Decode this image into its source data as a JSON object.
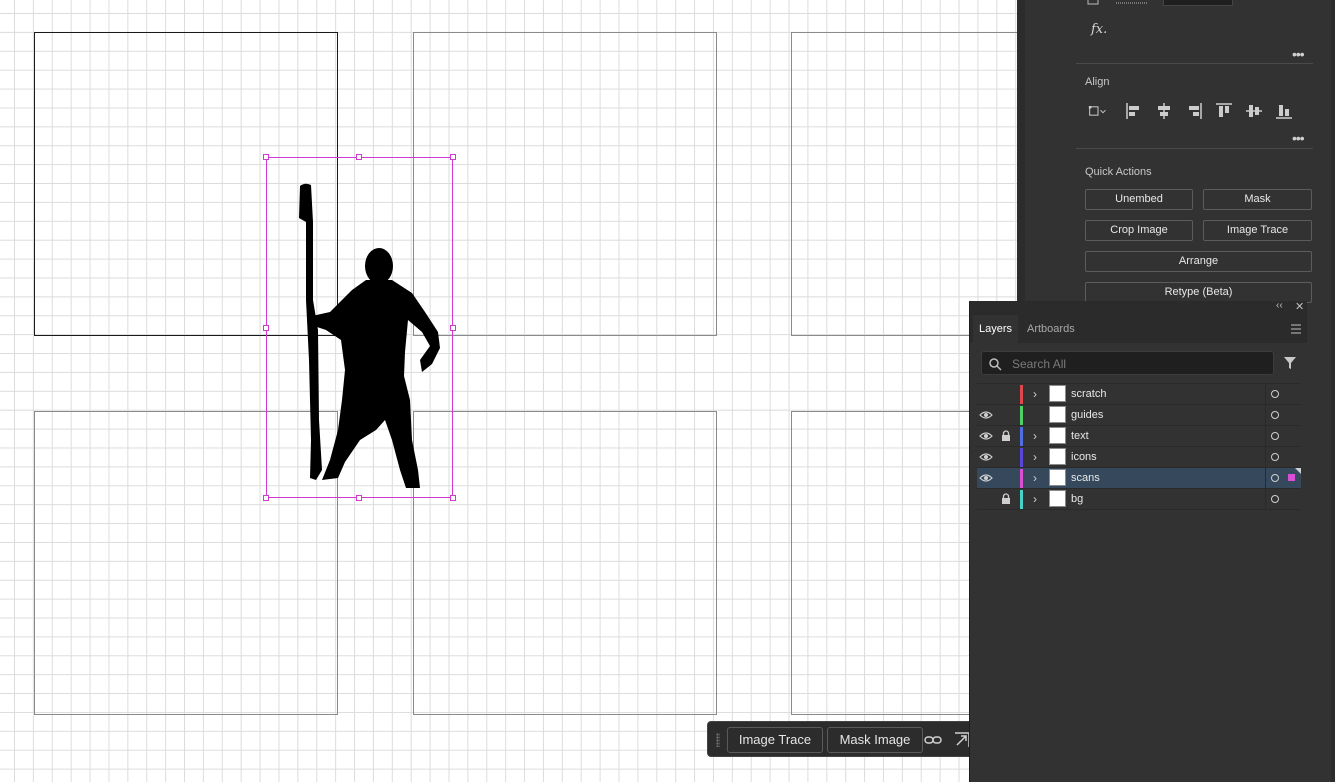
{
  "canvas": {
    "artboards": [
      "artboard-1",
      "artboard-2",
      "artboard-3",
      "artboard-4",
      "artboard-5",
      "artboard-6"
    ]
  },
  "taskbar": {
    "image_trace_label": "Image Trace",
    "mask_image_label": "Mask Image",
    "icons": [
      "link-icon",
      "expand-icon"
    ]
  },
  "properties": {
    "fx_label": "fx.",
    "align": {
      "title": "Align"
    },
    "quick_actions": {
      "title": "Quick Actions",
      "unembed": "Unembed",
      "mask": "Mask",
      "crop_image": "Crop Image",
      "image_trace": "Image Trace",
      "arrange": "Arrange",
      "retype": "Retype (Beta)"
    }
  },
  "layers_panel": {
    "tabs": [
      "Layers",
      "Artboards"
    ],
    "search_placeholder": "Search All",
    "layers": [
      {
        "name": "scratch",
        "color": "#e0474c",
        "visible": false,
        "locked": false,
        "expandable": true,
        "selected": false
      },
      {
        "name": "guides",
        "color": "#4fd163",
        "visible": true,
        "locked": false,
        "expandable": false,
        "selected": false
      },
      {
        "name": "text",
        "color": "#4f6fe0",
        "visible": true,
        "locked": true,
        "expandable": true,
        "selected": false
      },
      {
        "name": "icons",
        "color": "#5a46d8",
        "visible": true,
        "locked": false,
        "expandable": true,
        "selected": false
      },
      {
        "name": "scans",
        "color": "#d94fd4",
        "visible": true,
        "locked": false,
        "expandable": true,
        "selected": true
      },
      {
        "name": "bg",
        "color": "#48d1c9",
        "visible": false,
        "locked": true,
        "expandable": true,
        "selected": false
      }
    ]
  }
}
